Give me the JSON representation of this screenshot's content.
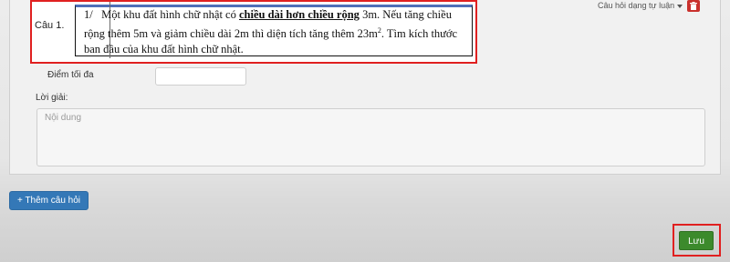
{
  "question": {
    "label": "Câu 1.",
    "number": "1/",
    "text_part1": "Một khu đất hình chữ nhật có ",
    "text_bold": "chiều dài hơn chiều rộng",
    "text_part2": " 3m. Nếu tăng chiều rộng thêm 5m và giảm chiều dài 2m thì diện tích tăng thêm 23m",
    "superscript": "2",
    "text_part3": ". Tìm kích thước ban đầu của khu đất hình chữ nhật."
  },
  "question_type": {
    "selected": "Câu hỏi dạng tự luận"
  },
  "icons": {
    "delete": "trash-icon",
    "caret": "caret-down-icon",
    "add": "plus-icon"
  },
  "score": {
    "label": "Điểm tối đa",
    "value": ""
  },
  "solution": {
    "label": "Lời giải:",
    "placeholder": "Nội dung"
  },
  "actions": {
    "add_question": "+ Thêm câu hỏi",
    "save": "Lưu"
  },
  "colors": {
    "highlight": "#e02020",
    "primary": "#3478b7",
    "success": "#3c8a2c",
    "danger": "#c9302c"
  }
}
